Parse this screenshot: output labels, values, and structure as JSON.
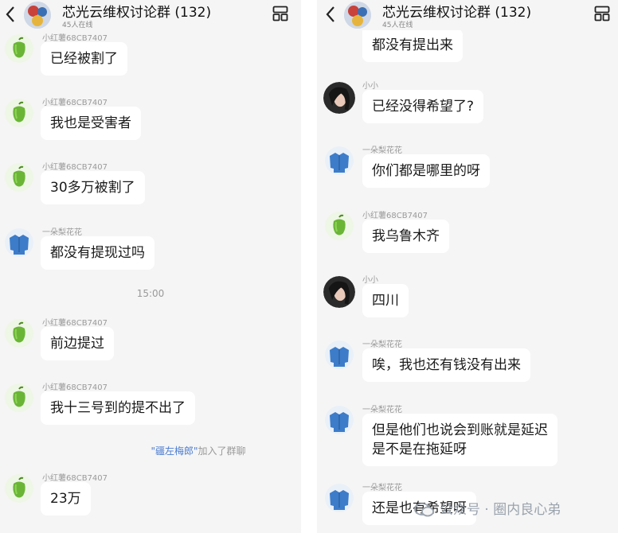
{
  "header": {
    "title": "芯光云维权讨论群 (132)",
    "online": "45人在线"
  },
  "left": {
    "messages": [
      {
        "sender": "小红薯68CB7407",
        "text": "已经被割了",
        "avatar": "pepper-icon"
      },
      {
        "sender": "小红薯68CB7407",
        "text": "我也是受害者",
        "avatar": "pepper-icon"
      },
      {
        "sender": "小红薯68CB7407",
        "text": "30多万被割了",
        "avatar": "pepper-icon"
      },
      {
        "sender": "一朵梨花花",
        "text": "都没有提现过吗",
        "avatar": "jacket-icon"
      },
      {
        "sender": "小红薯68CB7407",
        "text": "前边提过",
        "avatar": "pepper-icon"
      },
      {
        "sender": "小红薯68CB7407",
        "text": "我十三号到的提不出了",
        "avatar": "pepper-icon"
      },
      {
        "sender": "小红薯68CB7407",
        "text": "23万",
        "avatar": "pepper-icon"
      }
    ],
    "time": "15:00",
    "system": {
      "name": "\"疆左梅郎\"",
      "action": "加入了群聊"
    }
  },
  "right": {
    "partial_text": "都没有提出来",
    "messages": [
      {
        "sender": "小小",
        "text": "已经没得希望了?",
        "avatar": "girl-avatar"
      },
      {
        "sender": "一朵梨花花",
        "text": "你们都是哪里的呀",
        "avatar": "jacket-icon"
      },
      {
        "sender": "小红薯68CB7407",
        "text": "我乌鲁木齐",
        "avatar": "pepper-icon"
      },
      {
        "sender": "小小",
        "text": "四川",
        "avatar": "girl-avatar"
      },
      {
        "sender": "一朵梨花花",
        "text": "唉，我也还有钱没有出来",
        "avatar": "jacket-icon"
      },
      {
        "sender": "一朵梨花花",
        "text": "但是他们也说会到账就是延迟",
        "text2": "是不是在拖延呀",
        "avatar": "jacket-icon"
      },
      {
        "sender": "一朵梨花花",
        "text": "还是也有希望呀",
        "avatar": "jacket-icon"
      }
    ]
  },
  "watermark": "公众号 · 圈内良心弟",
  "colors": {
    "background": "#f5f5f5",
    "bubble": "#ffffff",
    "pepper": "#6ab536",
    "jacket": "#3d7cc9",
    "system_name": "#4a7bd0"
  }
}
